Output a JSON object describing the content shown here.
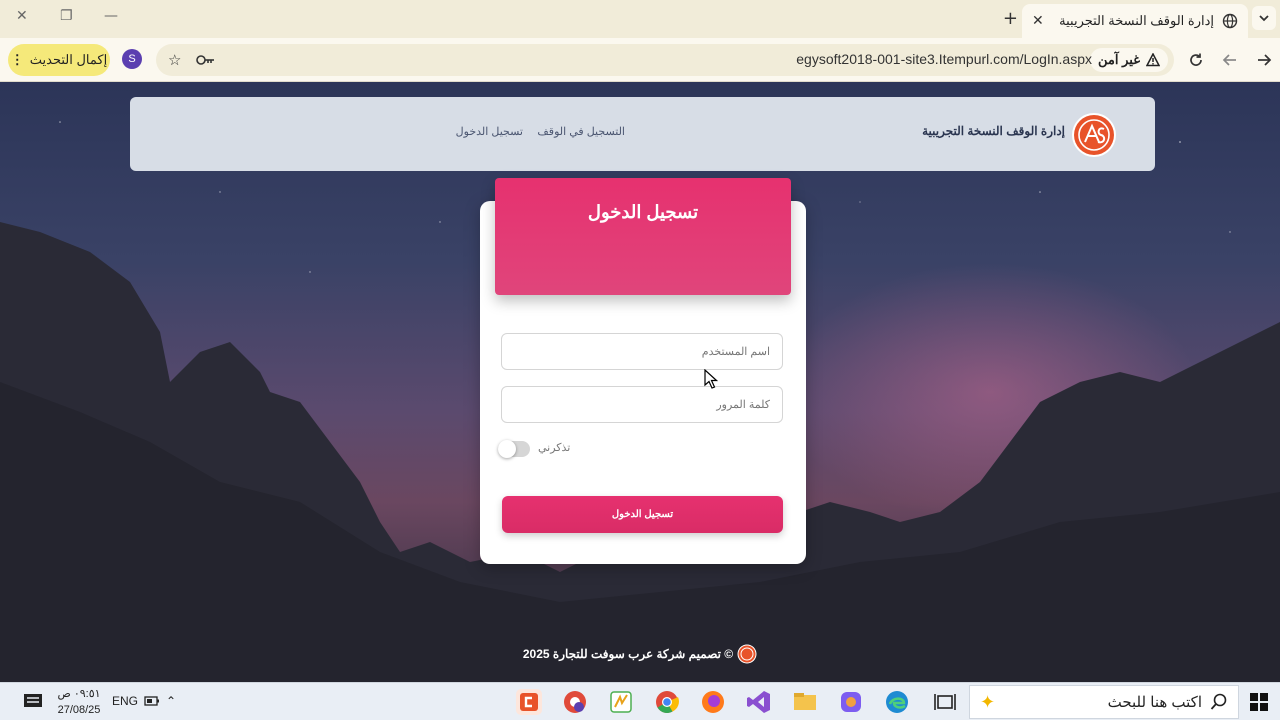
{
  "browser": {
    "tab_title": "إدارة الوقف النسخة التجريبية",
    "url": "egysoft2018-001-site3.Itempurl.com/LogIn.aspx",
    "security_label": "غير آمن",
    "update_button": "إكمال التحديث",
    "profile_initial": "S"
  },
  "site": {
    "brand": "إدارة الوقف النسخة التجريبية",
    "nav": {
      "register": "التسجيل في الوقف",
      "login": "تسجيل الدخول"
    }
  },
  "login": {
    "heading": "تسجيل الدخول",
    "username_placeholder": "اسم المستخدم",
    "password_placeholder": "كلمة المرور",
    "remember_me": "تذكرني",
    "remember_on": false,
    "submit": "تسجيل الدخول"
  },
  "footer": {
    "text": "© تصميم شركة عرب سوفت للتجارة 2025"
  },
  "taskbar": {
    "search_placeholder": "اكتب هنا للبحث",
    "language": "ENG",
    "time": "٠٩:٥١ ص",
    "date": "27/08/25"
  },
  "colors": {
    "accent": "#e6316f",
    "navbar": "#d7dde6",
    "update": "#f5e97a"
  }
}
